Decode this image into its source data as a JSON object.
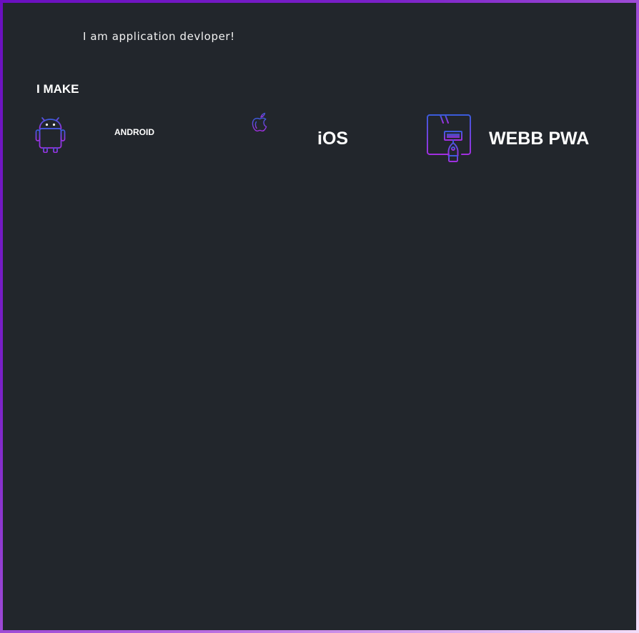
{
  "intro": {
    "tagline": "I am application devloper!"
  },
  "skills": {
    "heading": "I MAKE",
    "items": [
      {
        "label": "ANDROID",
        "icon": "android-icon"
      },
      {
        "label": "iOS",
        "icon": "apple-icon"
      },
      {
        "label": "WEBB PWA",
        "icon": "web-design-icon"
      }
    ]
  },
  "colors": {
    "background": "#22262c",
    "text": "#ffffff",
    "icon_gradient_start": "#3b5bdb",
    "icon_gradient_end": "#a12fe0",
    "frame_gradient": [
      "#6a0fbf",
      "#b86adf",
      "#f3ddf8"
    ]
  }
}
